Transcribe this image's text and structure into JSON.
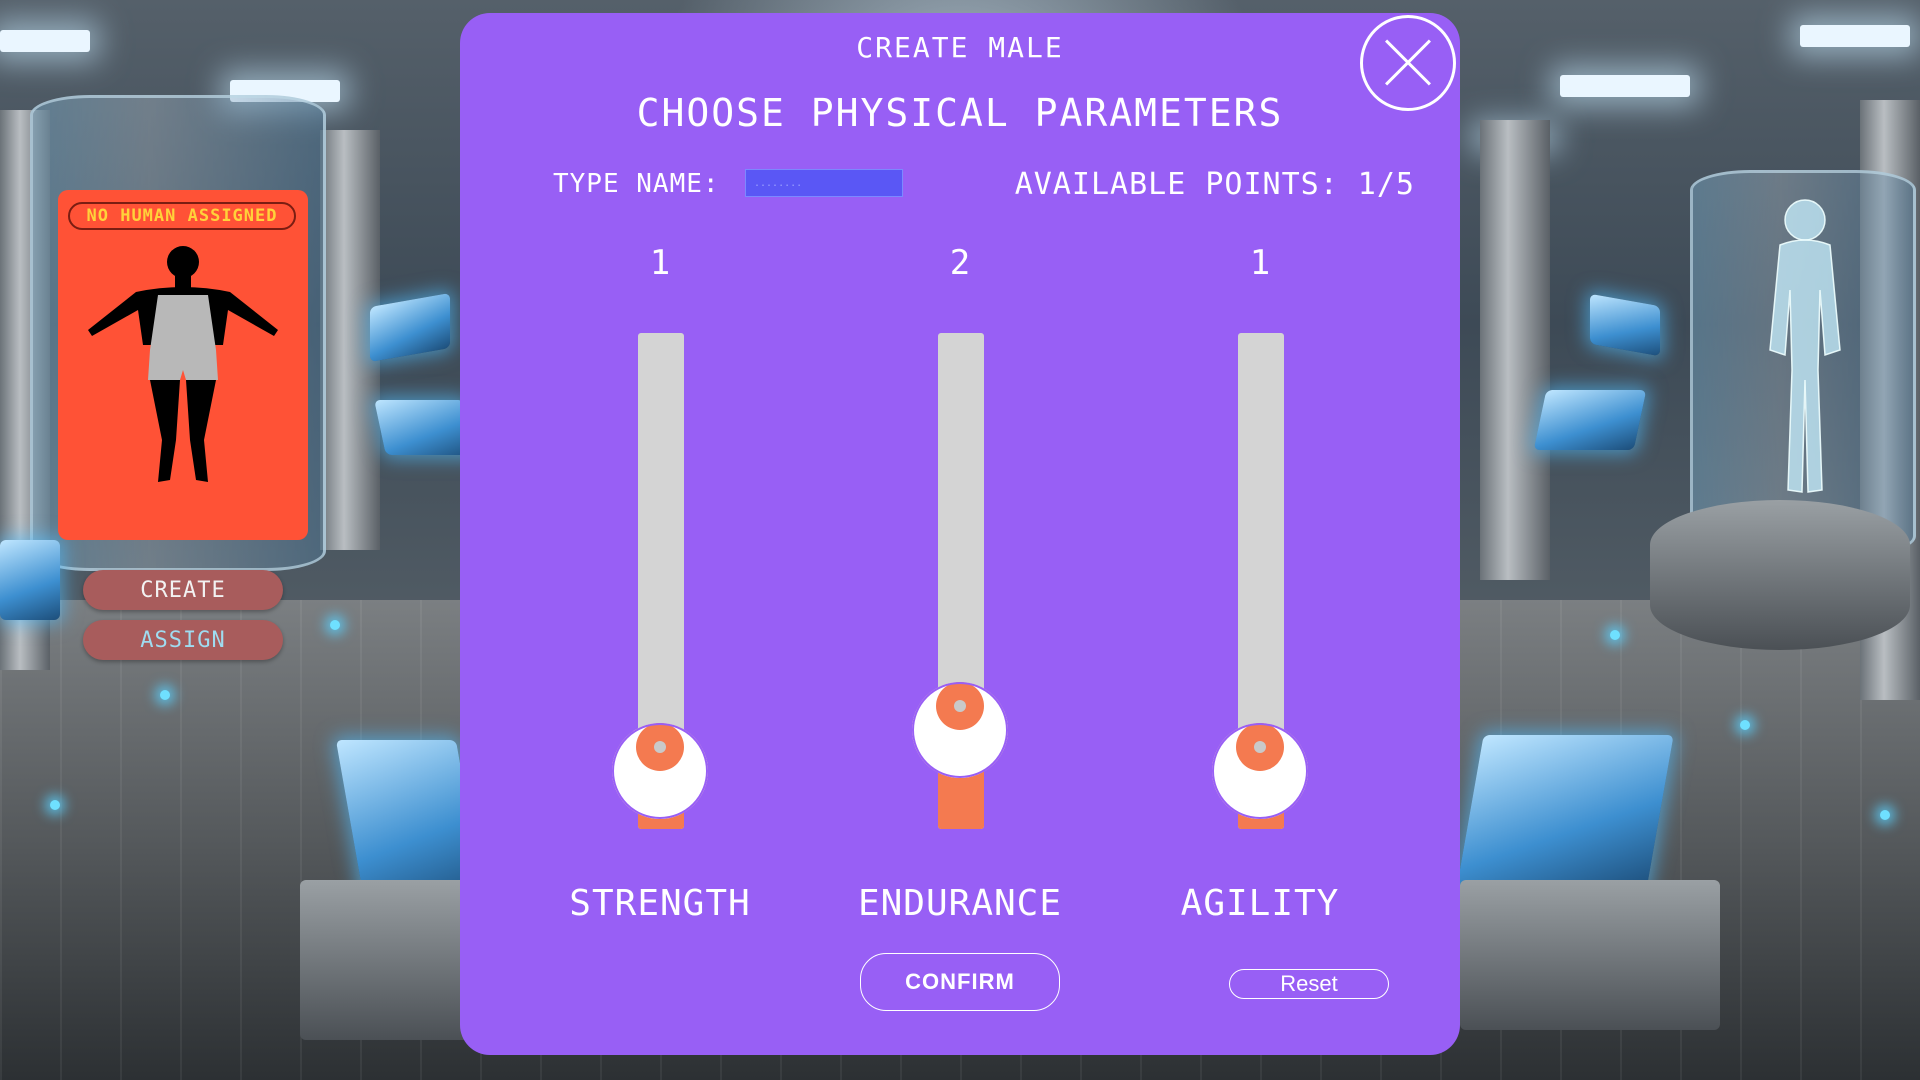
{
  "card": {
    "badge": "NO HUMAN ASSIGNED",
    "create_label": "CREATE",
    "assign_label": "ASSIGN"
  },
  "modal": {
    "title": "CREATE MALE",
    "heading": "CHOOSE PHYSICAL PARAMETERS",
    "name_label": "TYPE NAME:",
    "name_value": "",
    "name_placeholder": "........",
    "points_label": "AVAILABLE POINTS: 1/5",
    "confirm_label": "CONFIRM",
    "reset_label": "Reset"
  },
  "stats": [
    {
      "name": "STRENGTH",
      "value": "1",
      "level": 0.2
    },
    {
      "name": "ENDURANCE",
      "value": "2",
      "level": 0.4
    },
    {
      "name": "AGILITY",
      "value": "1",
      "level": 0.2
    }
  ],
  "colors": {
    "modal": "#985ff5",
    "card": "#ff5236",
    "badge_text": "#ffd23a",
    "slider_track": "#d4d4d4",
    "slider_fill": "#f47a50",
    "left_button": "#a85c5c",
    "name_input": "#5a57f5"
  },
  "icons": {
    "close": "close-icon",
    "slider_knob": "yin-yang-icon",
    "card_figure": "human-silhouette-icon"
  }
}
